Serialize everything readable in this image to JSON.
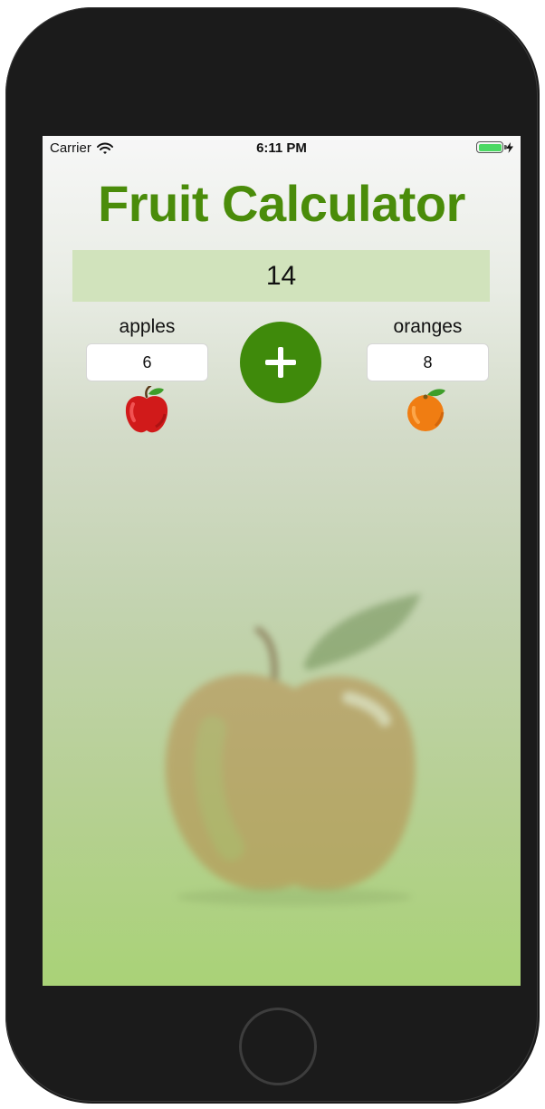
{
  "status_bar": {
    "carrier": "Carrier",
    "time": "6:11 PM",
    "battery_color": "#4cd964"
  },
  "app": {
    "title": "Fruit Calculator",
    "title_color": "#4a8c0a",
    "result": "14",
    "apples": {
      "label": "apples",
      "value": "6",
      "icon": "apple-icon"
    },
    "oranges": {
      "label": "oranges",
      "value": "8",
      "icon": "orange-icon"
    },
    "add_button": {
      "symbol": "+",
      "color": "#3f8a0b"
    }
  },
  "icons": {
    "wifi": "wifi-icon",
    "battery": "battery-icon",
    "charging": "bolt-icon",
    "background": "background-apple-image",
    "home": "home-button"
  }
}
